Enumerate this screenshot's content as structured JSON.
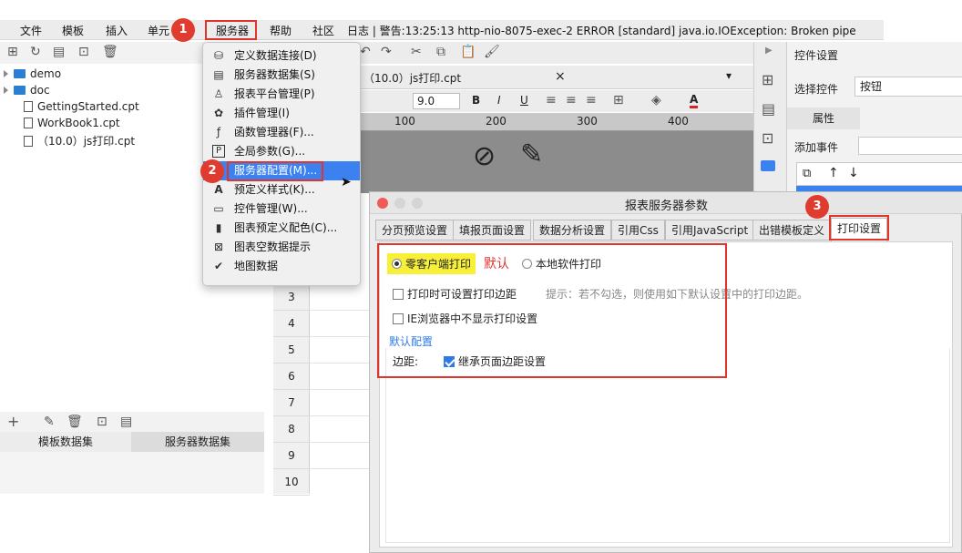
{
  "menubar": {
    "items": [
      "文件",
      "模板",
      "插入",
      "单元",
      "服务器",
      "帮助",
      "社区"
    ],
    "log": "日志 | 警告:13:25:13 http-nio-8075-exec-2 ERROR [standard] java.io.IOException: Broken pipe"
  },
  "tree": {
    "items": [
      "demo",
      "doc",
      "GettingStarted.cpt",
      "WorkBook1.cpt",
      "（10.0）js打印.cpt"
    ]
  },
  "left_tabs": [
    "模板数据集",
    "服务器数据集"
  ],
  "doc_tab": {
    "label": "（10.0）js打印.cpt",
    "close": "×"
  },
  "format_bar": {
    "font_size": "9.0",
    "bold": "B",
    "italic": "I",
    "underline": "U",
    "font_color": "A"
  },
  "ruler": {
    "ticks": [
      "100",
      "200",
      "300",
      "400"
    ]
  },
  "rows": [
    "3",
    "4",
    "5",
    "6",
    "7",
    "8",
    "9",
    "10"
  ],
  "right_panel": {
    "header": "控件设置",
    "select_label": "选择控件",
    "select_value": "按钮",
    "attr_tab": "属性",
    "event_label": "添加事件"
  },
  "dropdown": {
    "items": [
      {
        "icon": "define-connection-icon",
        "glyph": "⛁",
        "label": "定义数据连接(D)"
      },
      {
        "icon": "server-dataset-icon",
        "glyph": "▤",
        "label": "服务器数据集(S)"
      },
      {
        "icon": "platform-manager-icon",
        "glyph": "♙",
        "label": "报表平台管理(P)"
      },
      {
        "icon": "plugin-icon",
        "glyph": "✿",
        "label": "插件管理(I)"
      },
      {
        "icon": "function-manager-icon",
        "glyph": "ƒ",
        "label": "函数管理器(F)..."
      },
      {
        "icon": "global-param-icon",
        "glyph": "P",
        "label": "全局参数(G)..."
      },
      {
        "icon": "server-config-icon",
        "glyph": "⚙",
        "label": "服务器配置(M)..."
      },
      {
        "icon": "predefined-style-icon",
        "glyph": "A",
        "label": "预定义样式(K)..."
      },
      {
        "icon": "widget-manager-icon",
        "glyph": "▭",
        "label": "控件管理(W)..."
      },
      {
        "icon": "chart-color-icon",
        "glyph": "▮",
        "label": "图表预定义配色(C)..."
      },
      {
        "icon": "empty-data-icon",
        "glyph": "⊠",
        "label": "图表空数据提示"
      },
      {
        "icon": "map-data-icon",
        "glyph": "✔",
        "label": "地图数据"
      }
    ],
    "selected_index": 6
  },
  "dialog": {
    "title": "报表服务器参数",
    "tabs": [
      "分页预览设置",
      "填报页面设置",
      "数据分析设置",
      "引用Css",
      "引用JavaScript",
      "出错模板定义",
      "打印设置"
    ],
    "active_tab": 6,
    "zero_client_label": "零客户端打印",
    "default_label": "默认",
    "local_print_label": "本地软件打印",
    "set_margin_label": "打印时可设置打印边距",
    "hint": "提示：若不勾选，则使用如下默认设置中的打印边距。",
    "ie_hide_label": "IE浏览器中不显示打印设置",
    "default_config_label": "默认配置",
    "margin_label": "边距:",
    "inherit_label": "继承页面边距设置"
  },
  "steps": [
    "1",
    "2",
    "3"
  ],
  "colors": {
    "accent": "#3b82f0",
    "highlight_red": "#e0342c",
    "step_badge": "#e03b2f",
    "zero_client_bg": "#f7ef3a",
    "default_text": "#e0342c",
    "default_config": "#2f7be5"
  }
}
